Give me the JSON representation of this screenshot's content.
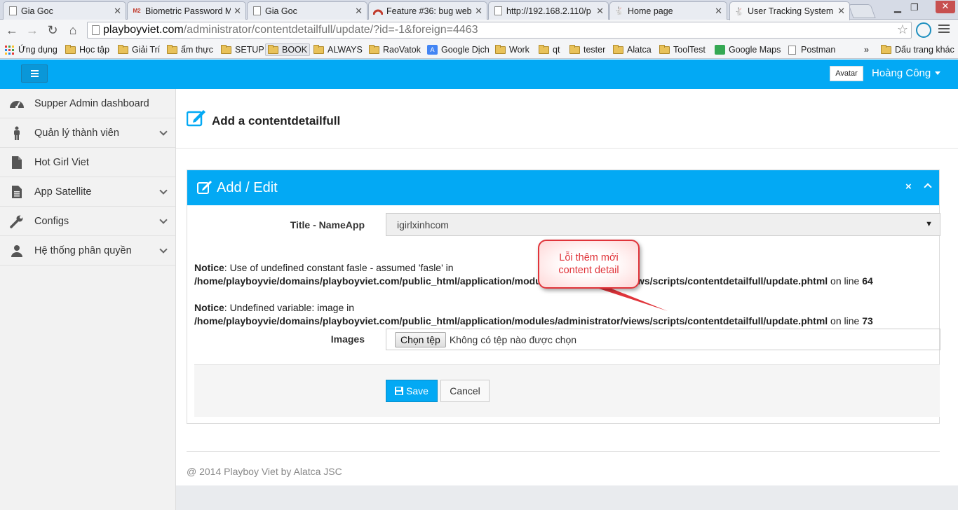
{
  "browser": {
    "tabs": [
      {
        "title": "Gia Goc",
        "active": false
      },
      {
        "title": "Biometric Password M",
        "active": false
      },
      {
        "title": "Gia Goc",
        "active": false
      },
      {
        "title": "Feature #36: bug web",
        "active": false
      },
      {
        "title": "http://192.168.2.110/p",
        "active": false
      },
      {
        "title": "Home page",
        "active": false
      },
      {
        "title": "User Tracking System",
        "active": true
      }
    ],
    "url_host": "playboyviet.com",
    "url_path": "/administrator/contentdetailfull/update/?id=-1&foreign=4463",
    "bookmarks": {
      "apps": "Ứng dụng",
      "items": [
        "Học tập",
        "Giải Trí",
        "ẩm thực",
        "SETUP",
        "BOOK",
        "ALWAYS",
        "RaoVatok",
        "Google Dịch",
        "Work",
        "qt",
        "tester",
        "Alatca",
        "ToolTest",
        "Google Maps",
        "Postman"
      ],
      "overflow": "»",
      "other": "Dấu trang khác"
    }
  },
  "header": {
    "avatar_label": "Avatar",
    "user_name": "Hoàng Công"
  },
  "sidebar": {
    "items": [
      {
        "label": "Supper Admin dashboard",
        "icon": "dashboard-icon",
        "has_children": false
      },
      {
        "label": "Quản lý thành viên",
        "icon": "user-figure-icon",
        "has_children": true
      },
      {
        "label": "Hot Girl Viet",
        "icon": "file-icon",
        "has_children": false
      },
      {
        "label": "App Satellite",
        "icon": "document-icon",
        "has_children": true
      },
      {
        "label": "Configs",
        "icon": "wrench-icon",
        "has_children": true
      },
      {
        "label": "Hệ thống phân quyền",
        "icon": "user-icon",
        "has_children": true
      }
    ]
  },
  "page": {
    "title": "Add a contentdetailfull"
  },
  "panel": {
    "title": "Add / Edit",
    "close_symbol": "×"
  },
  "form": {
    "title_label": "Title - NameApp",
    "title_value": "igirlxinhcom",
    "images_label": "Images",
    "choose_file_label": "Chọn tệp",
    "no_file_text": "Không có tệp nào được chọn",
    "save_label": "Save",
    "cancel_label": "Cancel"
  },
  "notices": [
    {
      "prefix": "Notice",
      "message": ": Use of undefined constant fasle - assumed 'fasle' in",
      "path": "/home/playboyvie/domains/playboyviet.com/public_html/application/modules/administrator/views/scripts/contentdetailfull/update.phtml",
      "on_line": " on line ",
      "line": "64"
    },
    {
      "prefix": "Notice",
      "message": ": Undefined variable: image in",
      "path": "/home/playboyvie/domains/playboyviet.com/public_html/application/modules/administrator/views/scripts/contentdetailfull/update.phtml",
      "on_line": " on line ",
      "line": "73"
    }
  ],
  "annotation": {
    "line1": "Lỗi thêm mới",
    "line2": "content detail"
  },
  "footer": {
    "copyright": "@ 2014 Playboy Viet by Alatca JSC"
  },
  "colors": {
    "primary": "#03a9f4",
    "annotation_red": "#e0343a"
  }
}
